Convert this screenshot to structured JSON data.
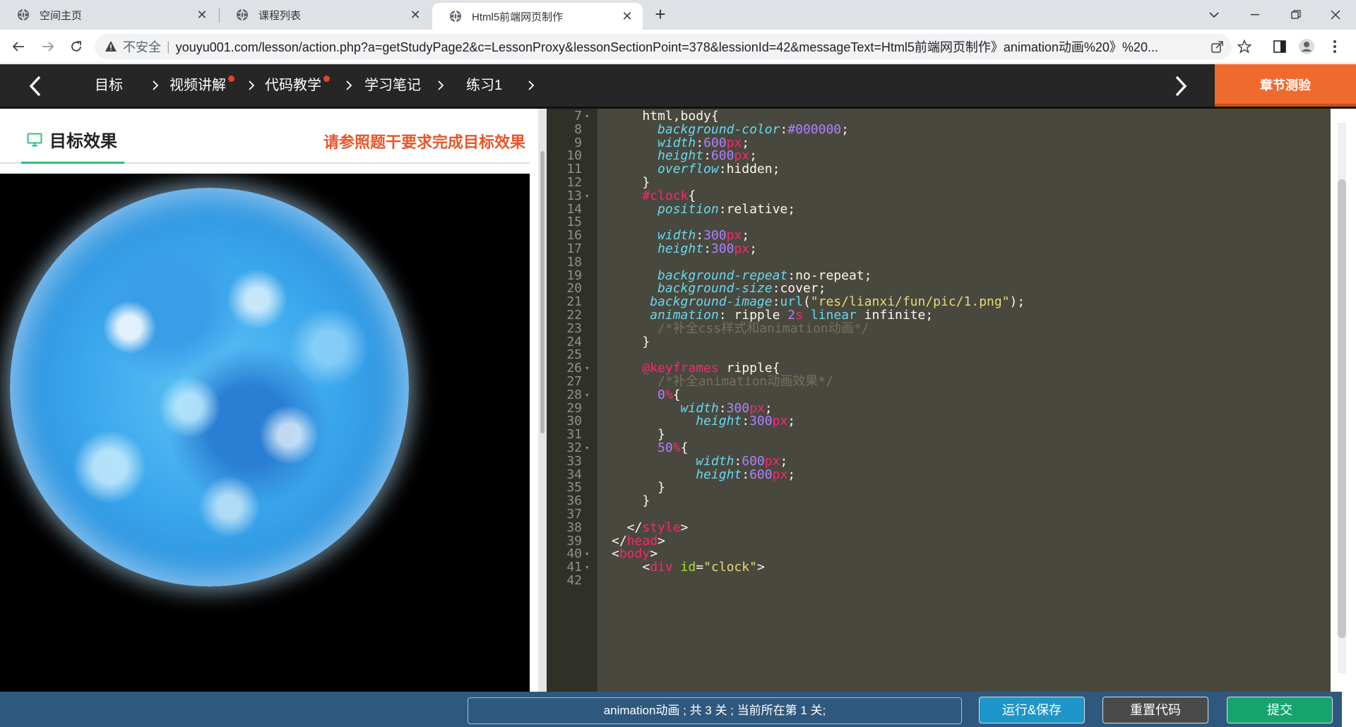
{
  "browser": {
    "tabs": [
      {
        "title": "空间主页",
        "active": false
      },
      {
        "title": "课程列表",
        "active": false
      },
      {
        "title": "Html5前端网页制作",
        "active": true
      }
    ],
    "new_tab": "+",
    "address": {
      "security_label": "不安全",
      "url": "youyu001.com/lesson/action.php?a=getStudyPage2&c=LessonProxy&lessonSectionPoint=378&lessionId=42&messageText=Html5前端网页制作》animation动画%20》%20..."
    }
  },
  "lesson_nav": {
    "items": [
      {
        "label": "目标",
        "badge": false
      },
      {
        "label": "视频讲解",
        "badge": true
      },
      {
        "label": "代码教学",
        "badge": true
      },
      {
        "label": "学习笔记",
        "badge": false
      },
      {
        "label": "练习1",
        "badge": false
      }
    ],
    "quiz_label": "章节测验"
  },
  "target_panel": {
    "title": "目标效果",
    "hint": "请参照题干要求完成目标效果"
  },
  "editor": {
    "lines": [
      {
        "n": "7",
        "fold": true,
        "html": "    <span class='tk-pl'>html,body{</span>"
      },
      {
        "n": "8",
        "fold": false,
        "html": "      <span class='tk-prop'>background-color</span>:<span class='tk-num'>#000000</span>;"
      },
      {
        "n": "9",
        "fold": false,
        "html": "      <span class='tk-prop'>width</span>:<span class='tk-num'>600</span><span class='tk-unit'>px</span>;"
      },
      {
        "n": "10",
        "fold": false,
        "html": "      <span class='tk-prop'>height</span>:<span class='tk-num'>600</span><span class='tk-unit'>px</span>;"
      },
      {
        "n": "11",
        "fold": false,
        "html": "      <span class='tk-prop'>overflow</span>:<span class='tk-pl'>hidden</span>;"
      },
      {
        "n": "12",
        "fold": false,
        "html": "    }"
      },
      {
        "n": "13",
        "fold": true,
        "html": "    <span class='tk-id'>#clock</span>{"
      },
      {
        "n": "14",
        "fold": false,
        "html": "      <span class='tk-prop'>position</span>:<span class='tk-pl'>relative</span>;"
      },
      {
        "n": "15",
        "fold": false,
        "html": ""
      },
      {
        "n": "16",
        "fold": false,
        "html": "      <span class='tk-prop'>width</span>:<span class='tk-num'>300</span><span class='tk-unit'>px</span>;"
      },
      {
        "n": "17",
        "fold": false,
        "html": "      <span class='tk-prop'>height</span>:<span class='tk-num'>300</span><span class='tk-unit'>px</span>;"
      },
      {
        "n": "18",
        "fold": false,
        "html": ""
      },
      {
        "n": "19",
        "fold": false,
        "html": "      <span class='tk-prop'>background-repeat</span>:<span class='tk-pl'>no-repeat</span>;"
      },
      {
        "n": "20",
        "fold": false,
        "html": "      <span class='tk-prop'>background-size</span>:<span class='tk-pl'>cover</span>;"
      },
      {
        "n": "21",
        "fold": false,
        "html": "     <span class='tk-prop'>background-image</span>:<span class='tk-fn'>url</span>(<span class='tk-str'>\"res/lianxi/fun/pic/1.png\"</span>);"
      },
      {
        "n": "22",
        "fold": false,
        "html": "     <span class='tk-prop'>animation</span>: ripple <span class='tk-num'>2</span><span class='tk-unit'>s</span> <span class='tk-lin'>linear</span> infinite;"
      },
      {
        "n": "23",
        "fold": false,
        "html": "      <span class='tk-com'>/*补全css样式和animation动画*/</span>"
      },
      {
        "n": "24",
        "fold": false,
        "html": "    }"
      },
      {
        "n": "25",
        "fold": false,
        "html": ""
      },
      {
        "n": "26",
        "fold": true,
        "html": "    <span class='tk-at'>@</span><span class='tk-at'>keyframes</span> ripple{"
      },
      {
        "n": "27",
        "fold": false,
        "html": "      <span class='tk-com'>/*补全animation动画效果*/</span>"
      },
      {
        "n": "28",
        "fold": true,
        "html": "      <span class='tk-num'>0</span><span class='tk-unit'>%</span>{"
      },
      {
        "n": "29",
        "fold": false,
        "html": "         <span class='tk-prop'>width</span>:<span class='tk-num'>300</span><span class='tk-unit'>px</span>;"
      },
      {
        "n": "30",
        "fold": false,
        "html": "           <span class='tk-prop'>height</span>:<span class='tk-num'>300</span><span class='tk-unit'>px</span>;"
      },
      {
        "n": "31",
        "fold": false,
        "html": "      }"
      },
      {
        "n": "32",
        "fold": true,
        "html": "      <span class='tk-num'>50</span><span class='tk-unit'>%</span>{"
      },
      {
        "n": "33",
        "fold": false,
        "html": "           <span class='tk-prop'>width</span>:<span class='tk-num'>600</span><span class='tk-unit'>px</span>;"
      },
      {
        "n": "34",
        "fold": false,
        "html": "           <span class='tk-prop'>height</span>:<span class='tk-num'>600</span><span class='tk-unit'>px</span>;"
      },
      {
        "n": "35",
        "fold": false,
        "html": "      }"
      },
      {
        "n": "36",
        "fold": false,
        "html": "    }"
      },
      {
        "n": "37",
        "fold": false,
        "html": ""
      },
      {
        "n": "38",
        "fold": false,
        "html": "  &lt;/<span class='tk-tag'>style</span>&gt;"
      },
      {
        "n": "39",
        "fold": false,
        "html": "&lt;/<span class='tk-tag'>head</span>&gt;"
      },
      {
        "n": "40",
        "fold": true,
        "html": "&lt;<span class='tk-tag'>body</span>&gt;"
      },
      {
        "n": "41",
        "fold": true,
        "html": "    &lt;<span class='tk-tag'>div</span> <span class='tk-attr'>id</span>=<span class='tk-str'>\"clock\"</span>&gt;"
      },
      {
        "n": "42",
        "fold": false,
        "html": ""
      }
    ]
  },
  "bottom_bar": {
    "status": "animation动画 ; 共 3 关 ; 当前所在第 1 关;",
    "run_label": "运行&保存",
    "reset_label": "重置代码",
    "submit_label": "提交"
  },
  "colors": {
    "nav_bg": "#262626",
    "quiz_orange": "#f06a2e",
    "hint_orange": "#e8562a",
    "accent_green": "#2bbf7e",
    "editor_bg": "#49483e",
    "bottom_bar": "#2f587e",
    "run_blue": "#1f96c9",
    "submit_green": "#16a46e"
  }
}
